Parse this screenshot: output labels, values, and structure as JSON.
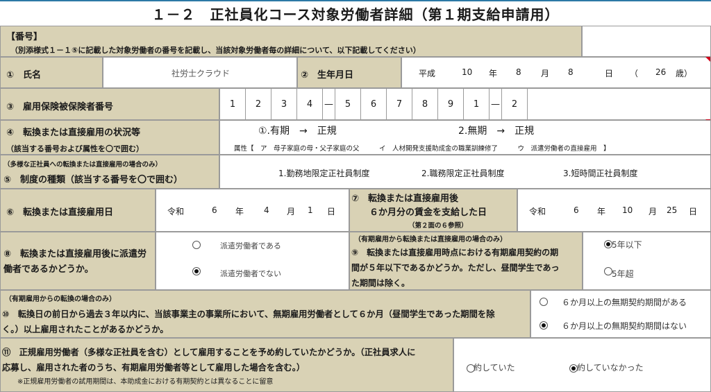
{
  "title": "１－２　正社員化コース対象労働者詳細（第１期支給申請用）",
  "bango": {
    "label": "【番号】",
    "note": "（別添様式１－１⑤に記載した対象労働者の番号を記載し、当該対象労働者毎の詳細について、以下記載してください）"
  },
  "row1": {
    "name_label": "①　氏名",
    "name_value": "社労士クラウド",
    "birth_label": "②　生年月日",
    "era": "平成",
    "year": "10",
    "year_unit": "年",
    "month": "8",
    "month_unit": "月",
    "day": "8",
    "day_unit": "日",
    "age_open": "（",
    "age": "26",
    "age_close": "歳）"
  },
  "row3": {
    "label": "③　雇用保険被保険者番号",
    "digits": [
      "1",
      "2",
      "3",
      "4",
      "—",
      "5",
      "6",
      "7",
      "8",
      "9",
      "1",
      "—",
      "2"
    ]
  },
  "row4": {
    "label": "④　転換または直接雇用の状況等",
    "sublabel": "（該当する番号および属性を〇で囲む）",
    "opt1": "①.有期　→　正規",
    "opt2": "2.無期　→　正規",
    "attr": "属性【　ア　母子家庭の母・父子家庭の父　　　イ　人材開発支援助成金の職業訓練修了　　　ウ　派遣労働者の直接雇用　】"
  },
  "row5": {
    "note": "（多様な正社員への転換または直接雇用の場合のみ）",
    "label": "⑤　制度の種類（該当する番号を〇で囲む）",
    "opt1": "1.勤務地限定正社員制度",
    "opt2": "2.職務限定正社員制度",
    "opt3": "3.短時間正社員制度"
  },
  "row6": {
    "label": "⑥　転換または直接雇用日",
    "era": "令和",
    "year": "6",
    "year_unit": "年",
    "month": "4",
    "month_unit": "月",
    "day": "1",
    "day_unit": "日",
    "label7_line1": "⑦　転換または直接雇用後",
    "label7_line2": "６か月分の賃金を支給した日",
    "label7_note": "（第２面の６参照）",
    "era7": "令和",
    "year7": "6",
    "month7": "10",
    "day7": "25"
  },
  "row8": {
    "label_line1": "⑧　転換または直接雇用後に派遣労",
    "label_line2": "働者であるかどうか。",
    "opt_yes": "派遣労働者である",
    "opt_no": "派遣労働者でない",
    "selected": "no",
    "note9": "（有期雇用から転換または直接雇用の場合のみ）",
    "label9_line1": "⑨　転換または直接雇用時点における有期雇用契約の期",
    "label9_line2": "間が５年以下であるかどうか。ただし、昼間学生であっ",
    "label9_line3": "た期間は除く。",
    "opt9_a": "5年以下",
    "opt9_b": "5年超",
    "selected9": "a"
  },
  "row10": {
    "note": "（有期雇用からの転換の場合のみ）",
    "label_line1": "⑩　転換日の前日から過去３年以内に、当該事業主の事業所において、無期雇用労働者として６か月（昼間学生であった期間を除",
    "label_line2": "く。）以上雇用されたことがあるかどうか。",
    "opt_a": "６か月以上の無期契約期間がある",
    "opt_b": "６か月以上の無期契約期間はない",
    "selected": "b"
  },
  "row11": {
    "label_line1": "⑪　正規雇用労働者（多様な正社員を含む）として雇用することを予め約していたかどうか。（正社員求人に",
    "label_line2": "応募し、雇用された者のうち、有期雇用労働者等として雇用した場合を含む。）",
    "note": "※正規雇用労働者の試用期間は、本助成金における有期契約とは異なることに留意",
    "opt_a": "約していた",
    "opt_b": "約していなかった",
    "selected": "b"
  },
  "colors": {
    "header_fill": "#d9d2b5",
    "border": "#9a9a9a",
    "marker": "#d0021b"
  }
}
